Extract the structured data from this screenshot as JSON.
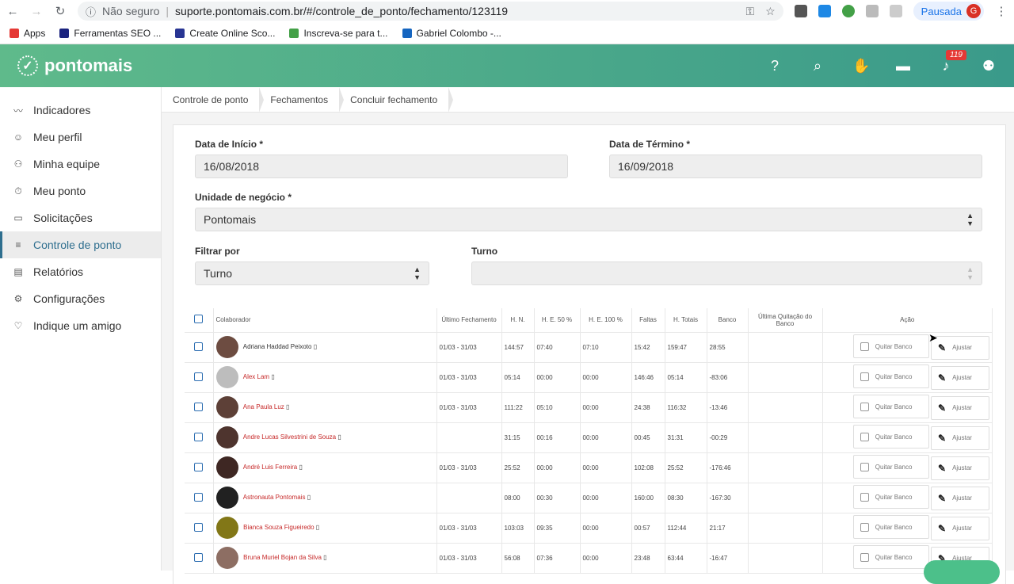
{
  "browser": {
    "not_secure": "Não seguro",
    "url": "suporte.pontomais.com.br/#/controle_de_ponto/fechamento/123119",
    "profile_label": "Pausada",
    "profile_initial": "G"
  },
  "bookmarks": [
    {
      "label": "Apps",
      "color": "#e53935"
    },
    {
      "label": "Ferramentas SEO ...",
      "color": "#1a237e"
    },
    {
      "label": "Create Online Sco...",
      "color": "#283593"
    },
    {
      "label": "Inscreva-se para t...",
      "color": "#43a047"
    },
    {
      "label": "Gabriel Colombo -...",
      "color": "#1565c0"
    }
  ],
  "app": {
    "logo_text": "pontomais",
    "notif_count": "119"
  },
  "sidebar": [
    {
      "label": "Indicadores",
      "icon": "chart-line-icon",
      "glyph": "〰"
    },
    {
      "label": "Meu perfil",
      "icon": "user-icon",
      "glyph": "☺"
    },
    {
      "label": "Minha equipe",
      "icon": "team-icon",
      "glyph": "⚇"
    },
    {
      "label": "Meu ponto",
      "icon": "stopwatch-icon",
      "glyph": "⏱"
    },
    {
      "label": "Solicitações",
      "icon": "chat-icon",
      "glyph": "▭"
    },
    {
      "label": "Controle de ponto",
      "icon": "list-icon",
      "glyph": "≡",
      "active": true
    },
    {
      "label": "Relatórios",
      "icon": "document-icon",
      "glyph": "▤"
    },
    {
      "label": "Configurações",
      "icon": "gear-icon",
      "glyph": "⚙"
    },
    {
      "label": "Indique um amigo",
      "icon": "heart-icon",
      "glyph": "♡"
    }
  ],
  "breadcrumb": [
    "Controle de ponto",
    "Fechamentos",
    "Concluir fechamento"
  ],
  "form": {
    "start_label": "Data de Início *",
    "start_value": "16/08/2018",
    "end_label": "Data de Término *",
    "end_value": "16/09/2018",
    "unit_label": "Unidade de negócio *",
    "unit_value": "Pontomais",
    "filter_label": "Filtrar por",
    "filter_value": "Turno",
    "turno_label": "Turno",
    "turno_value": ""
  },
  "table": {
    "headers": [
      "Colaborador",
      "Último Fechamento",
      "H. N.",
      "H. E. 50 %",
      "H. E. 100 %",
      "Faltas",
      "H. Totais",
      "Banco",
      "Última Quitação do Banco",
      "Ação"
    ],
    "quitar_label": "Quitar Banco",
    "ajustar_label": "Ajustar",
    "rows": [
      {
        "name": "Adriana Haddad Peixoto",
        "fech": "01/03 - 31/03",
        "hn": "144:57",
        "he50": "07:40",
        "he100": "07:10",
        "faltas": "15:42",
        "totais": "159:47",
        "banco": "28:55",
        "quit": "",
        "dark": true,
        "av": "#6d4c41"
      },
      {
        "name": "Alex Lam",
        "fech": "01/03 - 31/03",
        "hn": "05:14",
        "he50": "00:00",
        "he100": "00:00",
        "faltas": "146:46",
        "totais": "05:14",
        "banco": "-83:06",
        "quit": "",
        "av": "#bdbdbd"
      },
      {
        "name": "Ana Paula Luz",
        "fech": "01/03 - 31/03",
        "hn": "111:22",
        "he50": "05:10",
        "he100": "00:00",
        "faltas": "24:38",
        "totais": "116:32",
        "banco": "-13:46",
        "quit": "",
        "av": "#5d4037"
      },
      {
        "name": "Andre Lucas Silvestrini de Souza",
        "fech": "",
        "hn": "31:15",
        "he50": "00:16",
        "he100": "00:00",
        "faltas": "00:45",
        "totais": "31:31",
        "banco": "-00:29",
        "quit": "",
        "av": "#4e342e"
      },
      {
        "name": "André Luis Ferreira",
        "fech": "01/03 - 31/03",
        "hn": "25:52",
        "he50": "00:00",
        "he100": "00:00",
        "faltas": "102:08",
        "totais": "25:52",
        "banco": "-176:46",
        "quit": "",
        "av": "#3e2723"
      },
      {
        "name": "Astronauta Pontomais",
        "fech": "",
        "hn": "08:00",
        "he50": "00:30",
        "he100": "00:00",
        "faltas": "160:00",
        "totais": "08:30",
        "banco": "-167:30",
        "quit": "",
        "av": "#212121"
      },
      {
        "name": "Bianca Souza Figueiredo",
        "fech": "01/03 - 31/03",
        "hn": "103:03",
        "he50": "09:35",
        "he100": "00:00",
        "faltas": "00:57",
        "totais": "112:44",
        "banco": "21:17",
        "quit": "",
        "av": "#827717"
      },
      {
        "name": "Bruna Muriel Bojan da Silva",
        "fech": "01/03 - 31/03",
        "hn": "56:08",
        "he50": "07:36",
        "he100": "00:00",
        "faltas": "23:48",
        "totais": "63:44",
        "banco": "-16:47",
        "quit": "",
        "av": "#8d6e63"
      }
    ]
  }
}
